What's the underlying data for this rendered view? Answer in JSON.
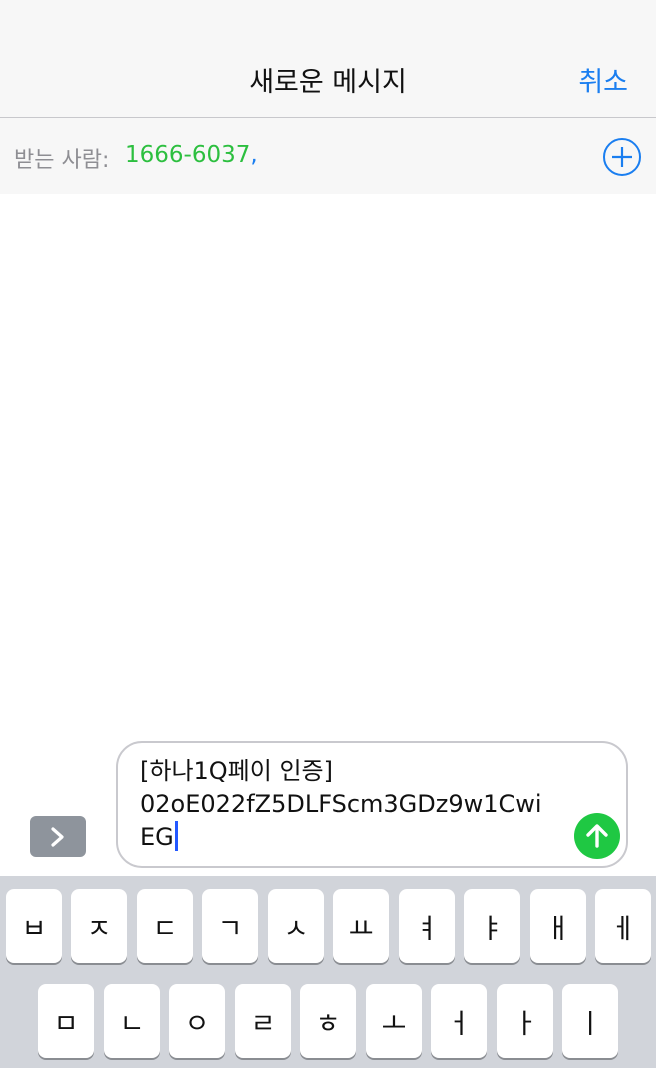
{
  "nav": {
    "title": "새로운 메시지",
    "cancel_label": "취소"
  },
  "recipient": {
    "label": "받는 사람:",
    "value": "1666-6037",
    "separator": ","
  },
  "composer": {
    "message_text": "[하나1Q페이 인증]\n02oE022fZ5DLFScm3GDz9w1Cwi\nEG",
    "expand_icon": "chevron-right-icon",
    "send_icon": "arrow-up-icon",
    "send_color": "#1fc843"
  },
  "keyboard": {
    "row1": [
      "ㅂ",
      "ㅈ",
      "ㄷ",
      "ㄱ",
      "ㅅ",
      "ㅛ",
      "ㅕ",
      "ㅑ",
      "ㅐ",
      "ㅔ"
    ],
    "row2": [
      "ㅁ",
      "ㄴ",
      "ㅇ",
      "ㄹ",
      "ㅎ",
      "ㅗ",
      "ㅓ",
      "ㅏ",
      "ㅣ"
    ]
  },
  "colors": {
    "accent": "#1a7ef0",
    "recipient": "#2cbf3f",
    "caret": "#2358ff"
  }
}
